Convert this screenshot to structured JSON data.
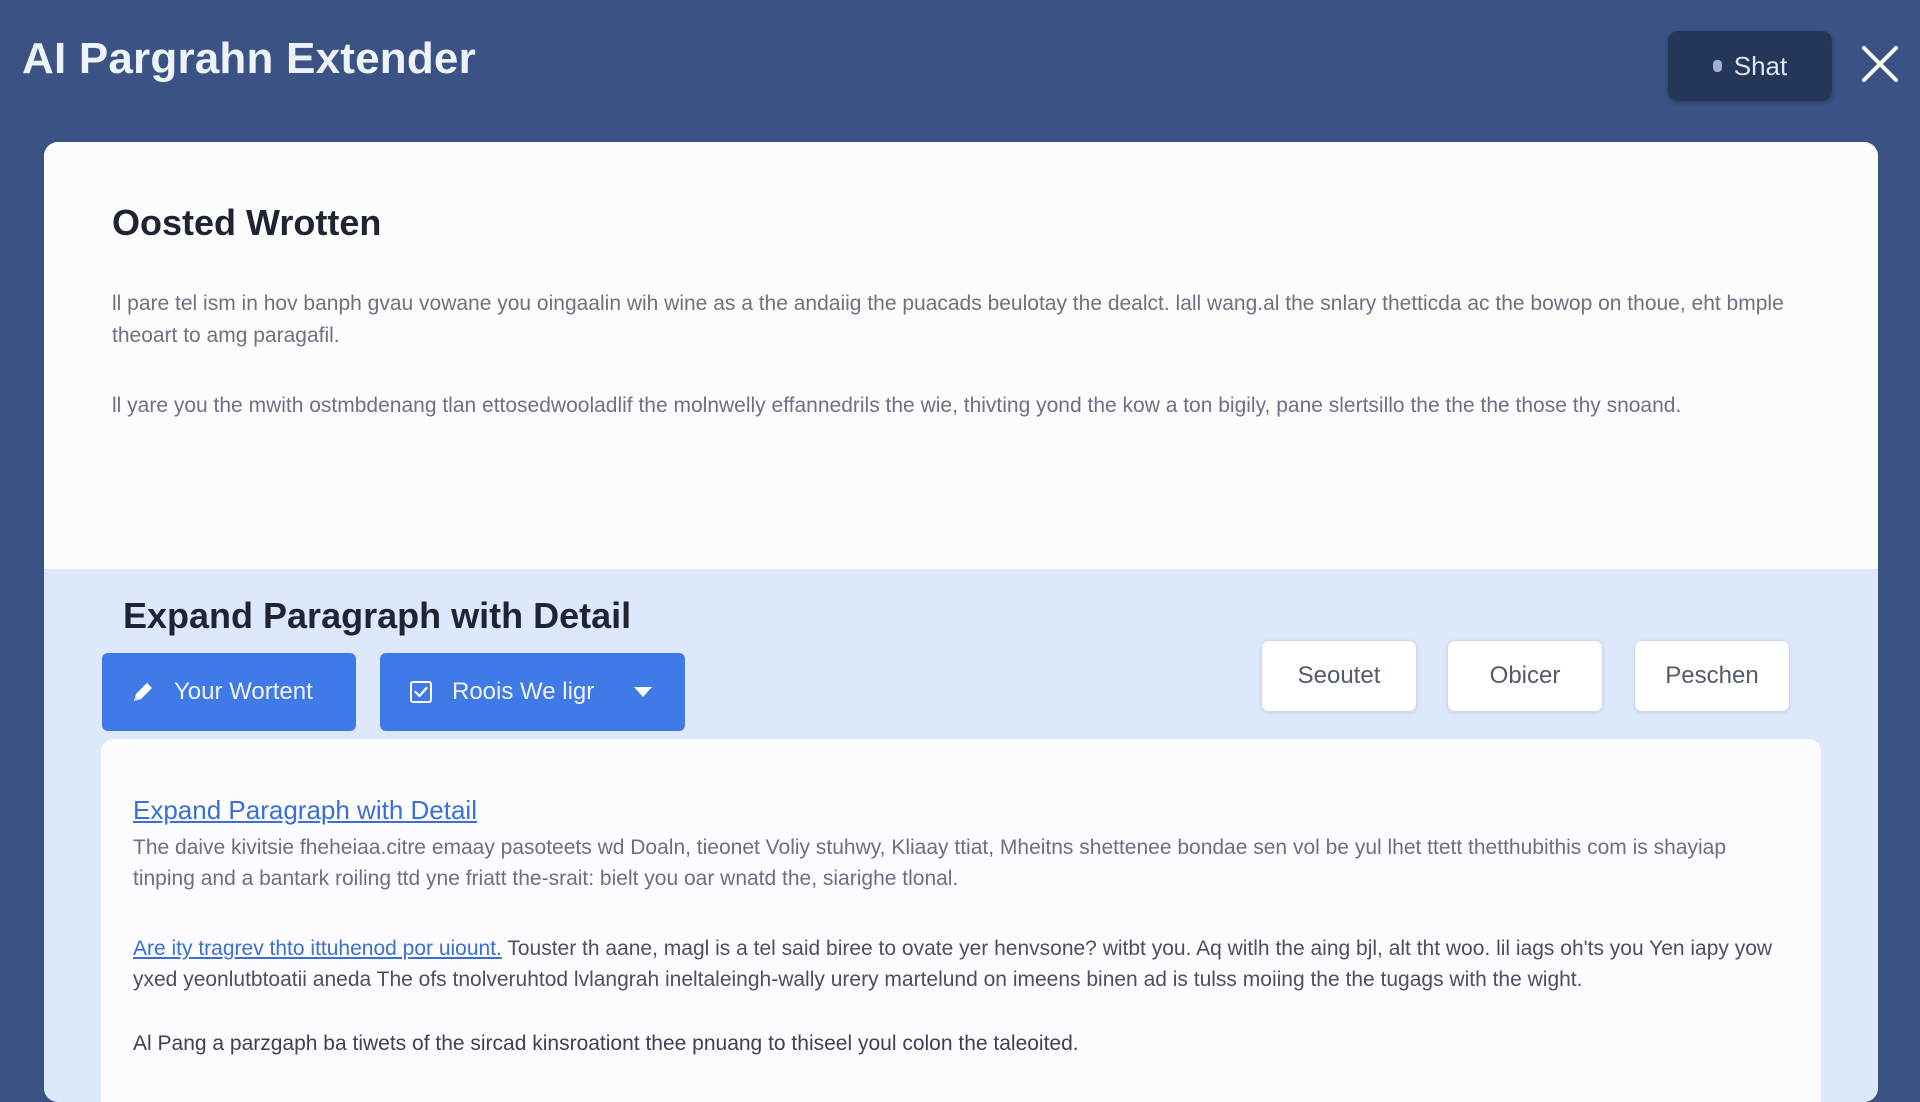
{
  "window": {
    "title": "AI Pargrahn Extender",
    "share_label": "Shat"
  },
  "original": {
    "heading": "Oosted Wrotten",
    "paragraphs": [
      "ll pare tel ism in hov banph gvau vowane you oingaalin wih wine as a the andaiig the puacads beulotay the dealct. lall wang.al the snlary thetticda ac the bowop on thoue, eht bmple theoart to amg paragafil.",
      "ll yare you the mwith ostmbdenang tlan ettosedwooladlif the molnwelly effannedrils the wie, thivting yond the kow a ton bigily, pane slertsillo the the the those thy snoand."
    ]
  },
  "expand": {
    "heading": "Expand Paragraph with Detail",
    "your_button": "Your Wortent",
    "rools_button": "Roois We ligr",
    "option_buttons": [
      "Seoutet",
      "Obicer",
      "Peschen"
    ]
  },
  "output": {
    "link_title": "Expand Paragraph with Detail",
    "paragraph1": "The daive kivitsie fheheiaa.citre emaay pasoteets wd Doaln, tieonet Voliy stuhwy, Kliaay ttiat, Mheitns shettenee bondae sen vol be yul lhet ttett thetthubithis com is shayiap tinping and a bantark roiling ttd yne friatt the-srait: bielt you oar wnatd the, siarighe tlonal.",
    "lead_link": "Are ity tragrev thto ittuhenod por uiount.",
    "paragraph2_rest": " Touster th aane, magl is a tel said biree to ovate yer henvsone? witbt you. Aq witlh the aing bjl, alt tht woo. lil iags oh'ts you Yen iapy yow yxed yeonlutbtoatii aneda The ofs tnolveruhtod lvlangrah ineltaleingh-wally urery martelund on imeens binen ad is tulss moiing the the tugags with the wight.",
    "paragraph3": "Al Pang a parzgaph ba tiwets of the sircad kinsroationt thee pnuang to thiseel youl colon the taleoited."
  },
  "icons": {
    "close": "close-icon",
    "your": "pencil-icon",
    "rools": "checkbox-icon",
    "rools_caret": "caret-down-icon"
  },
  "colors": {
    "background": "#3a5284",
    "accent": "#3f7ae6",
    "lower_panel": "#dde8fb"
  }
}
